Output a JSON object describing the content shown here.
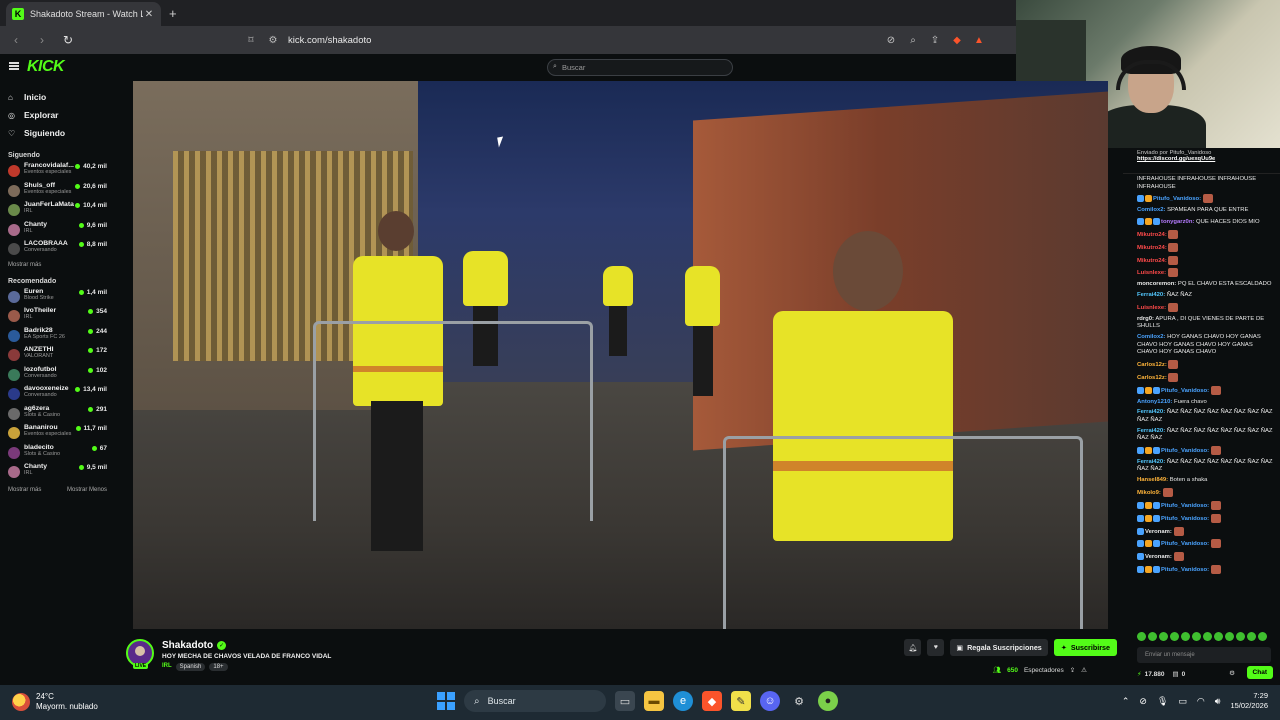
{
  "browser": {
    "tab_title": "Shakadoto Stream - Watch Li",
    "tab_favicon": "K",
    "tab_close": "✕",
    "new_tab": "+",
    "url": "kick.com/shakadoto"
  },
  "kick": {
    "logo": "KICK",
    "search_placeholder": "Buscar"
  },
  "sidebar": {
    "nav": [
      {
        "label": "Inicio",
        "icon": "home-icon"
      },
      {
        "label": "Explorar",
        "icon": "compass-icon"
      },
      {
        "label": "Siguiendo",
        "icon": "heart-icon"
      }
    ],
    "following_title": "Siguendo",
    "following": [
      {
        "name": "Francovidalaf...",
        "category": "Eventos especiales",
        "viewers": "40,2 mil",
        "color": "#c0392b"
      },
      {
        "name": "Shuls_off",
        "category": "Eventos especiales",
        "viewers": "20,6 mil",
        "color": "#7d6b5a"
      },
      {
        "name": "JuanFerLaMata",
        "category": "IRL",
        "viewers": "10,4 mil",
        "color": "#6a8a4a"
      },
      {
        "name": "Chanty",
        "category": "IRL",
        "viewers": "9,6 mil",
        "color": "#a86a8a"
      },
      {
        "name": "LACOBRAAA",
        "category": "Conversando",
        "viewers": "8,8 mil",
        "color": "#4a4a4a"
      }
    ],
    "following_more": "Mostrar más",
    "recommended_title": "Recomendado",
    "recommended": [
      {
        "name": "Euren",
        "category": "Blood Strike",
        "viewers": "1,4 mil",
        "color": "#5a6a9a"
      },
      {
        "name": "IvoTheiler",
        "category": "IRL",
        "viewers": "354",
        "color": "#9a5a4a"
      },
      {
        "name": "Badrik28",
        "category": "EA Sports FC 26",
        "viewers": "244",
        "color": "#2a5a9a"
      },
      {
        "name": "ANZETHI",
        "category": "VALORANT",
        "viewers": "172",
        "color": "#8a3a3a"
      },
      {
        "name": "lozofutbol",
        "category": "Conversando",
        "viewers": "102",
        "color": "#3a7a5a"
      },
      {
        "name": "davooxeneize",
        "category": "Conversando",
        "viewers": "13,4 mil",
        "color": "#2a3a8a"
      },
      {
        "name": "ag6zera",
        "category": "Slots & Casino",
        "viewers": "291",
        "color": "#6a6a6a"
      },
      {
        "name": "Bananirou",
        "category": "Eventos especiales",
        "viewers": "11,7 mil",
        "color": "#c9a23a"
      },
      {
        "name": "bladecito",
        "category": "Slots & Casino",
        "viewers": "67",
        "color": "#7a3a7a"
      },
      {
        "name": "Chanty",
        "category": "IRL",
        "viewers": "9,5 mil",
        "color": "#a86a8a"
      }
    ],
    "show_more": "Mostrar más",
    "show_less": "Mostrar Menos"
  },
  "stream": {
    "name": "Shakadoto",
    "title": "HOY MECHA DE CHAVOS VELADA DE FRANCO VIDAL",
    "category": "IRL",
    "tags": [
      "Spanish",
      "18+"
    ],
    "live_badge": "LIVE",
    "gift_label": "Regala Suscripciones",
    "subscribe_label": "Suscribirse",
    "viewer_count": "650",
    "viewer_label": "Espectadores"
  },
  "chat": {
    "pinned_sender": "Enviado por",
    "pinned_user": "Pitufo_Vanidoso",
    "pinned_link": "https://discord.gg/uexqUu9e",
    "messages": [
      {
        "user": "",
        "text": "INFRAHOUSE INFRAHOUSE INFRAHOUSE INFRAHOUSE",
        "color": "#eaeaea",
        "emote": false,
        "badges": 0
      },
      {
        "user": "Pitufo_Vanidoso:",
        "text": "",
        "color": "#4aa3ff",
        "emote": true,
        "badges": 2
      },
      {
        "user": "Comilox2:",
        "text": "SPAMEAN PARA QUE ENTRE",
        "color": "#4aa3ff",
        "emote": false,
        "badges": 0
      },
      {
        "user": "tonygarz0n:",
        "text": "QUE HACES DIOS MIO",
        "color": "#b57bff",
        "emote": false,
        "badges": 3
      },
      {
        "user": "Mikutro24:",
        "text": "",
        "color": "#ff4a4a",
        "emote": true,
        "badges": 0
      },
      {
        "user": "Mikutro24:",
        "text": "",
        "color": "#ff4a4a",
        "emote": true,
        "badges": 0
      },
      {
        "user": "Mikutro24:",
        "text": "",
        "color": "#ff4a4a",
        "emote": true,
        "badges": 0
      },
      {
        "user": "Luisnlexe:",
        "text": "",
        "color": "#ff4a4a",
        "emote": true,
        "badges": 0
      },
      {
        "user": "moncoremon:",
        "text": "PQ EL CHAVO ESTA ESCALDADO",
        "color": "#eaeaea",
        "emote": false,
        "badges": 0
      },
      {
        "user": "Ferrai420:",
        "text": "ÑAZ ÑAZ",
        "color": "#53c8ff",
        "emote": false,
        "badges": 0
      },
      {
        "user": "Luisnlexe:",
        "text": "",
        "color": "#ff4a4a",
        "emote": true,
        "badges": 0
      },
      {
        "user": "rdrg0:",
        "text": "APURA , DI QUE VIENES DE PARTE DE SHULLS",
        "color": "#eaeaea",
        "emote": false,
        "badges": 0
      },
      {
        "user": "Comilox2:",
        "text": "HOY GANAS CHAVO HOY GANAS CHAVO HOY GANAS CHAVO HOY GANAS CHAVO HOY GANAS CHAVO",
        "color": "#4aa3ff",
        "emote": false,
        "badges": 0
      },
      {
        "user": "Carlos12z:",
        "text": "",
        "color": "#ffb43a",
        "emote": true,
        "badges": 0
      },
      {
        "user": "Carlos12z:",
        "text": "",
        "color": "#ffb43a",
        "emote": true,
        "badges": 0
      },
      {
        "user": "Pitufo_Vanidoso:",
        "text": "",
        "color": "#4aa3ff",
        "emote": true,
        "badges": 3
      },
      {
        "user": "Antony1210:",
        "text": "Fuera chavo",
        "color": "#4aa3ff",
        "emote": false,
        "badges": 0
      },
      {
        "user": "Ferrai420:",
        "text": "ÑAZ ÑAZ ÑAZ ÑAZ ÑAZ ÑAZ ÑAZ ÑAZ ÑAZ ÑAZ",
        "color": "#53c8ff",
        "emote": false,
        "badges": 0
      },
      {
        "user": "Ferrai420:",
        "text": "ÑAZ ÑAZ ÑAZ ÑAZ ÑAZ ÑAZ ÑAZ ÑAZ ÑAZ ÑAZ",
        "color": "#53c8ff",
        "emote": false,
        "badges": 0
      },
      {
        "user": "Pitufo_Vanidoso:",
        "text": "",
        "color": "#4aa3ff",
        "emote": true,
        "badges": 3
      },
      {
        "user": "Ferrai420:",
        "text": "ÑAZ ÑAZ ÑAZ ÑAZ ÑAZ ÑAZ ÑAZ ÑAZ ÑAZ ÑAZ",
        "color": "#53c8ff",
        "emote": false,
        "badges": 0
      },
      {
        "user": "Hansel849:",
        "text": "Boten a shaka",
        "color": "#ffb43a",
        "emote": false,
        "badges": 0
      },
      {
        "user": "Mikolo9:",
        "text": "",
        "color": "#ffb43a",
        "emote": true,
        "badges": 0
      },
      {
        "user": "Pitufo_Vanidoso:",
        "text": "",
        "color": "#4aa3ff",
        "emote": true,
        "badges": 3
      },
      {
        "user": "Pitufo_Vanidoso:",
        "text": "",
        "color": "#4aa3ff",
        "emote": true,
        "badges": 3
      },
      {
        "user": "Veronam:",
        "text": "",
        "color": "#eaeaea",
        "emote": true,
        "badges": 1
      },
      {
        "user": "Pitufo_Vanidoso:",
        "text": "",
        "color": "#4aa3ff",
        "emote": true,
        "badges": 3
      },
      {
        "user": "Veronam:",
        "text": "",
        "color": "#eaeaea",
        "emote": true,
        "badges": 1
      },
      {
        "user": "Pitufo_Vanidoso:",
        "text": "",
        "color": "#4aa3ff",
        "emote": true,
        "badges": 3
      }
    ],
    "input_placeholder": "Enviar un mensaje",
    "points": "17.880",
    "count2": "0",
    "chat_button": "Chat"
  },
  "taskbar": {
    "temperature": "24°C",
    "weather": "Mayorm. nublado",
    "search": "Buscar",
    "time": "7:29",
    "date": "15/02/2026"
  },
  "colors": {
    "accent": "#53fc18",
    "bg": "#0b0e0f"
  }
}
